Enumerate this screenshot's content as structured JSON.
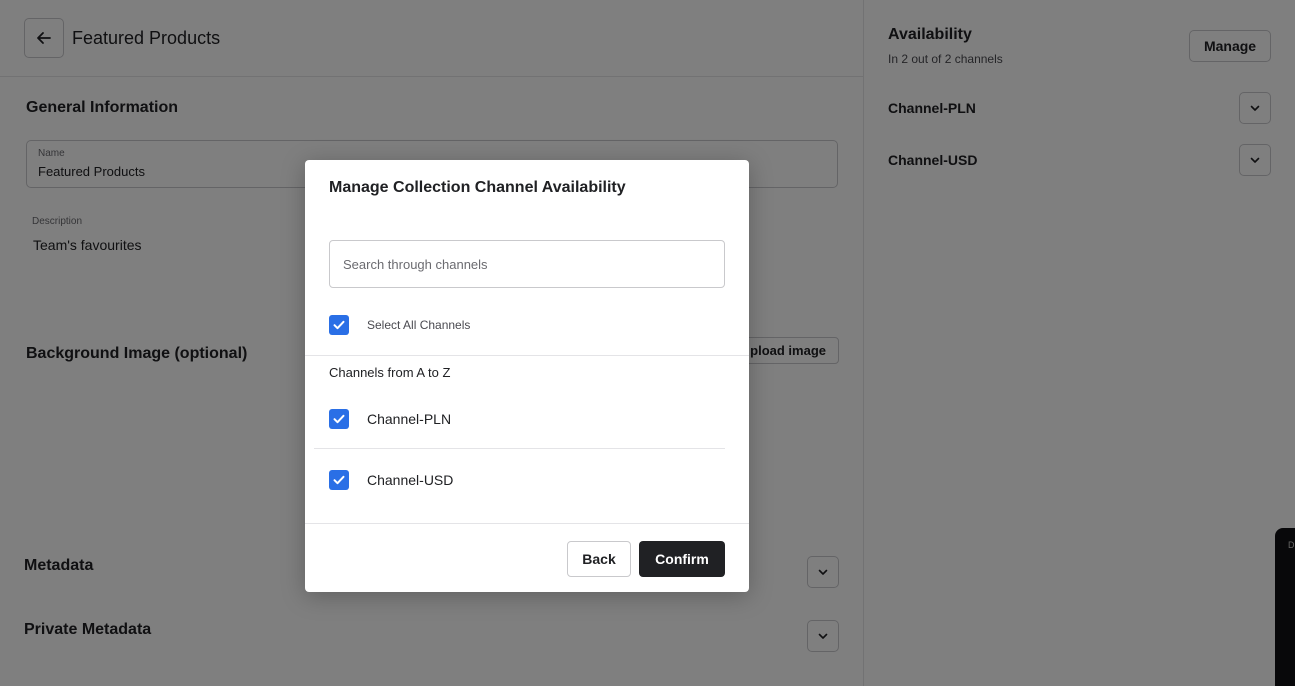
{
  "header": {
    "title": "Featured Products"
  },
  "general_info": {
    "title": "General Information",
    "name_label": "Name",
    "name_value": "Featured Products",
    "description_label": "Description",
    "description_value": "Team's favourites"
  },
  "background_image": {
    "title": "Background Image (optional)",
    "upload_label": "pload image"
  },
  "metadata": {
    "title": "Metadata"
  },
  "private_metadata": {
    "title": "Private Metadata"
  },
  "availability": {
    "title": "Availability",
    "subtitle": "In 2 out of 2 channels",
    "manage_label": "Manage",
    "channels": [
      "Channel-PLN",
      "Channel-USD"
    ]
  },
  "dark_panel": {
    "label": "D"
  },
  "modal": {
    "title": "Manage Collection Channel Availability",
    "search_placeholder": "Search through channels",
    "select_all_label": "Select All Channels",
    "select_all_checked": true,
    "group_label": "Channels from A to Z",
    "channels": [
      {
        "name": "Channel-PLN",
        "checked": true
      },
      {
        "name": "Channel-USD",
        "checked": true
      }
    ],
    "back_label": "Back",
    "confirm_label": "Confirm"
  },
  "colors": {
    "accent": "#2a6fe6",
    "primary_button": "#202124",
    "overlay": "rgba(0,0,0,0.5)"
  }
}
